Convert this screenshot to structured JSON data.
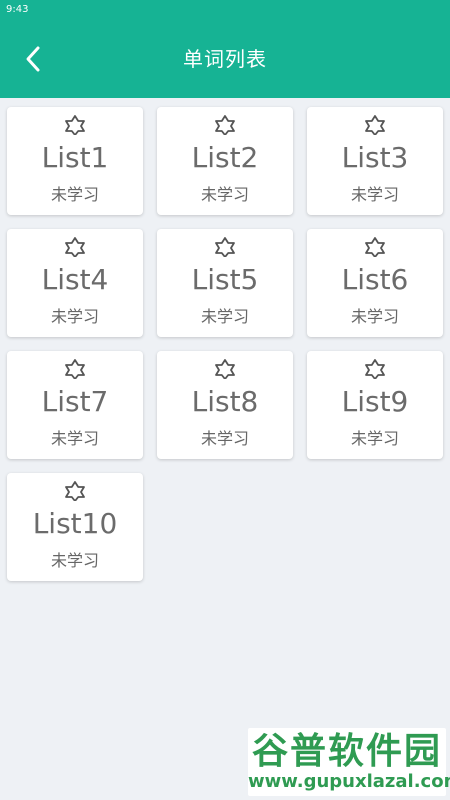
{
  "status_bar": {
    "time": "9:43"
  },
  "header": {
    "title": "单词列表",
    "back_icon": "chevron-left-icon"
  },
  "lists": [
    {
      "name": "List1",
      "status": "未学习"
    },
    {
      "name": "List2",
      "status": "未学习"
    },
    {
      "name": "List3",
      "status": "未学习"
    },
    {
      "name": "List4",
      "status": "未学习"
    },
    {
      "name": "List5",
      "status": "未学习"
    },
    {
      "name": "List6",
      "status": "未学习"
    },
    {
      "name": "List7",
      "status": "未学习"
    },
    {
      "name": "List8",
      "status": "未学习"
    },
    {
      "name": "List9",
      "status": "未学习"
    },
    {
      "name": "List10",
      "status": "未学习"
    }
  ],
  "watermark": {
    "title": "谷普软件园",
    "url": "www.gupuxlazal.com"
  },
  "colors": {
    "primary": "#16b394",
    "background": "#eef1f5",
    "card": "#ffffff",
    "text": "#6b6b6b",
    "watermark": "#2f9b52"
  }
}
